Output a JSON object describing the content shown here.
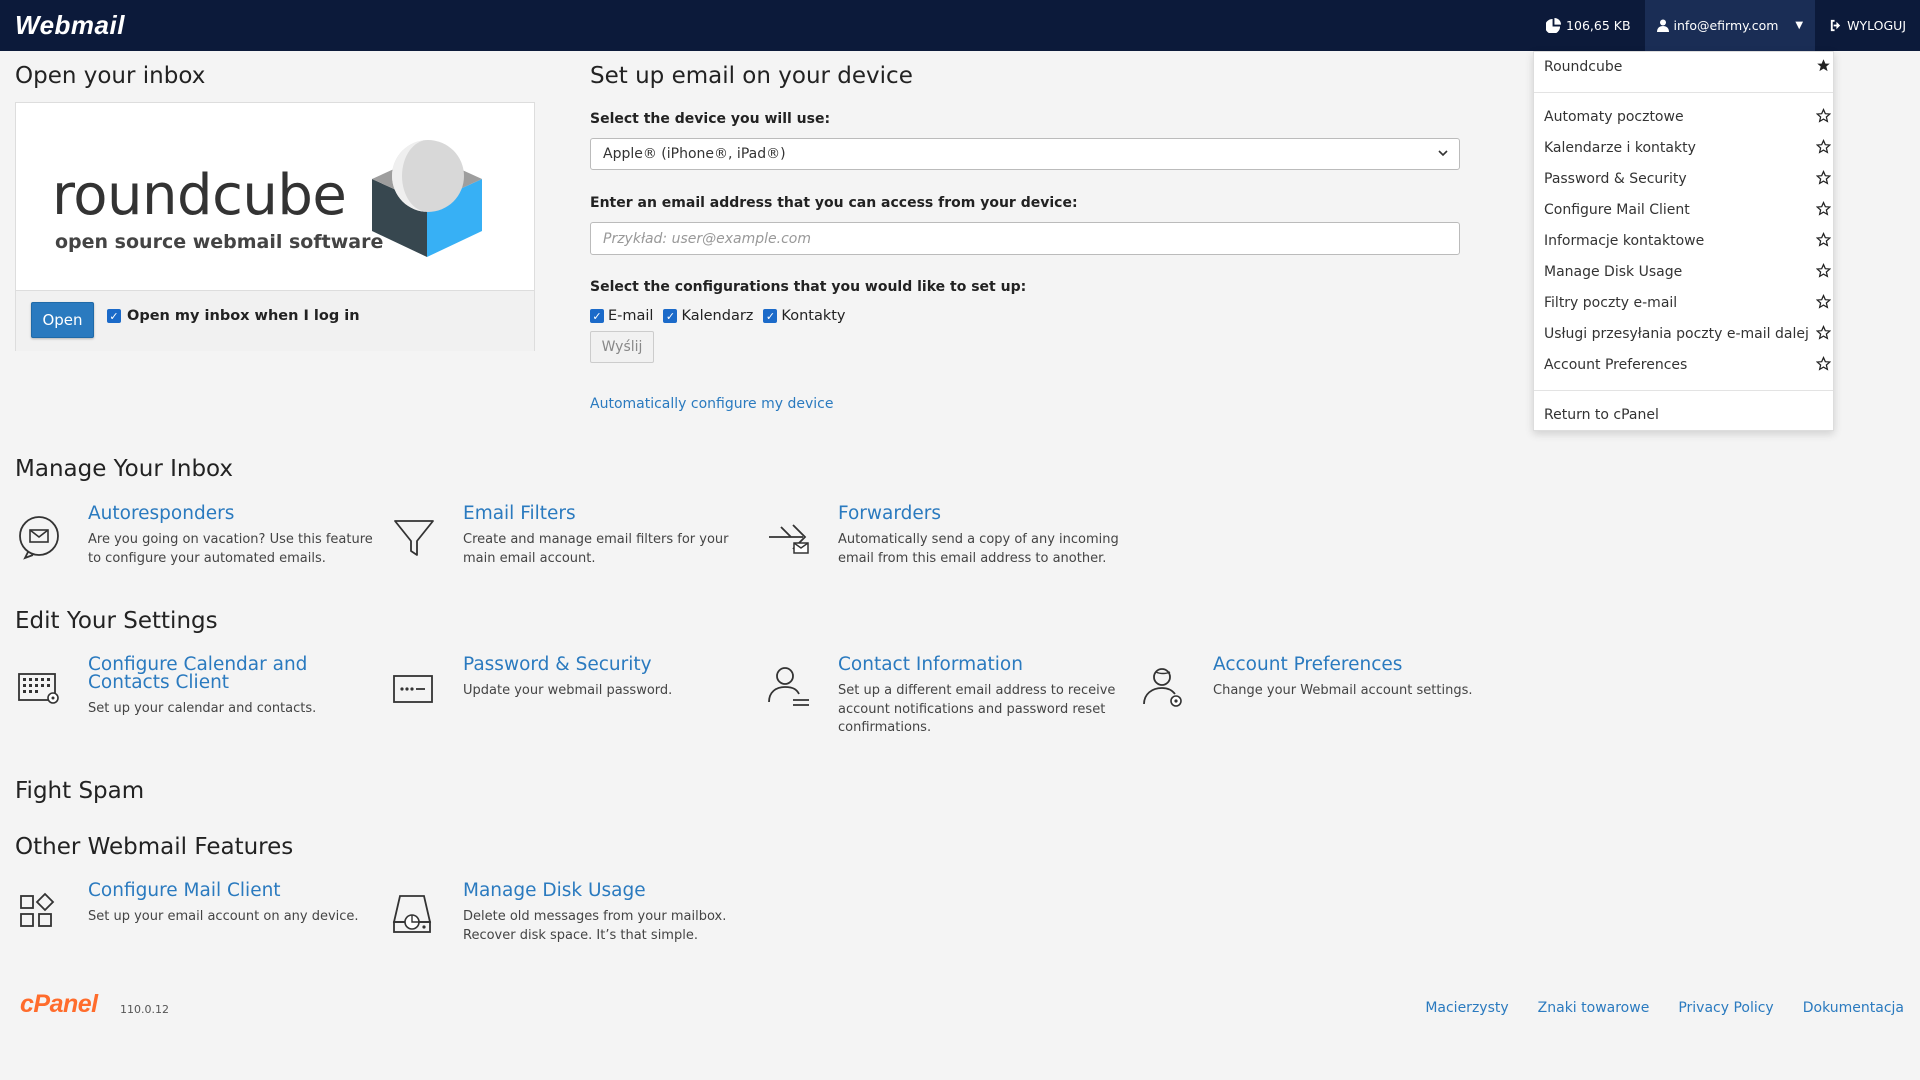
{
  "topbar": {
    "logo": "Webmail",
    "disk_usage": "106,65 KB",
    "user_email": "info@efirmy.com",
    "logout": "WYLOGUJ"
  },
  "inbox": {
    "heading": "Open your inbox",
    "rc_word": "roundcube",
    "rc_sub": "open source webmail software",
    "open_button": "Open",
    "open_on_login": "Open my inbox when I log in"
  },
  "setup": {
    "heading": "Set up email on your device",
    "device_label": "Select the device you will use:",
    "device_value": "Apple® (iPhone®, iPad®)",
    "email_label": "Enter an email address that you can access from your device:",
    "email_placeholder": "Przykład: user@example.com",
    "config_label": "Select the configurations that you would like to set up:",
    "configs": [
      "E-mail",
      "Kalendarz",
      "Kontakty"
    ],
    "send_button": "Wyślij",
    "auto_link": "Automatically configure my device"
  },
  "manage": {
    "heading": "Manage Your Inbox",
    "items": [
      {
        "title": "Autoresponders",
        "desc": "Are you going on vacation? Use this feature to configure your automated emails.",
        "icon": "autoresponder-icon"
      },
      {
        "title": "Email Filters",
        "desc": "Create and manage email filters for your main email account.",
        "icon": "filter-icon"
      },
      {
        "title": "Forwarders",
        "desc": "Automatically send a copy of any incoming email from this email address to another.",
        "icon": "forward-icon"
      }
    ]
  },
  "settings": {
    "heading": "Edit Your Settings",
    "items": [
      {
        "title": "Configure Calendar and Contacts Client",
        "desc": "Set up your calendar and contacts.",
        "icon": "calendar-icon"
      },
      {
        "title": "Password & Security",
        "desc": "Update your webmail password.",
        "icon": "password-icon"
      },
      {
        "title": "Contact Information",
        "desc": "Set up a different email address to receive account notifications and password reset confirmations.",
        "icon": "contact-icon"
      },
      {
        "title": "Account Preferences",
        "desc": "Change your Webmail account settings.",
        "icon": "account-prefs-icon"
      }
    ]
  },
  "spam": {
    "heading": "Fight Spam"
  },
  "other": {
    "heading": "Other Webmail Features",
    "items": [
      {
        "title": "Configure Mail Client",
        "desc": "Set up your email account on any device.",
        "icon": "apps-icon"
      },
      {
        "title": "Manage Disk Usage",
        "desc": "Delete old messages from your mailbox. Recover disk space. It’s that simple.",
        "icon": "disk-icon"
      }
    ]
  },
  "dropdown": {
    "top": "Roundcube",
    "items": [
      "Automaty pocztowe",
      "Kalendarze i kontakty",
      "Password & Security",
      "Configure Mail Client",
      "Informacje kontaktowe",
      "Manage Disk Usage",
      "Filtry poczty e-mail",
      "Usługi przesyłania poczty e-mail dalej",
      "Account Preferences"
    ],
    "bottom": "Return to cPanel"
  },
  "footer": {
    "logo": "cPanel",
    "version": "110.0.12",
    "links": [
      "Macierzysty",
      "Znaki towarowe",
      "Privacy Policy",
      "Dokumentacja"
    ]
  },
  "colors": {
    "topbar": "#0c1a3a",
    "link": "#2a7abf",
    "cpanel_orange": "#ff6c2c"
  }
}
